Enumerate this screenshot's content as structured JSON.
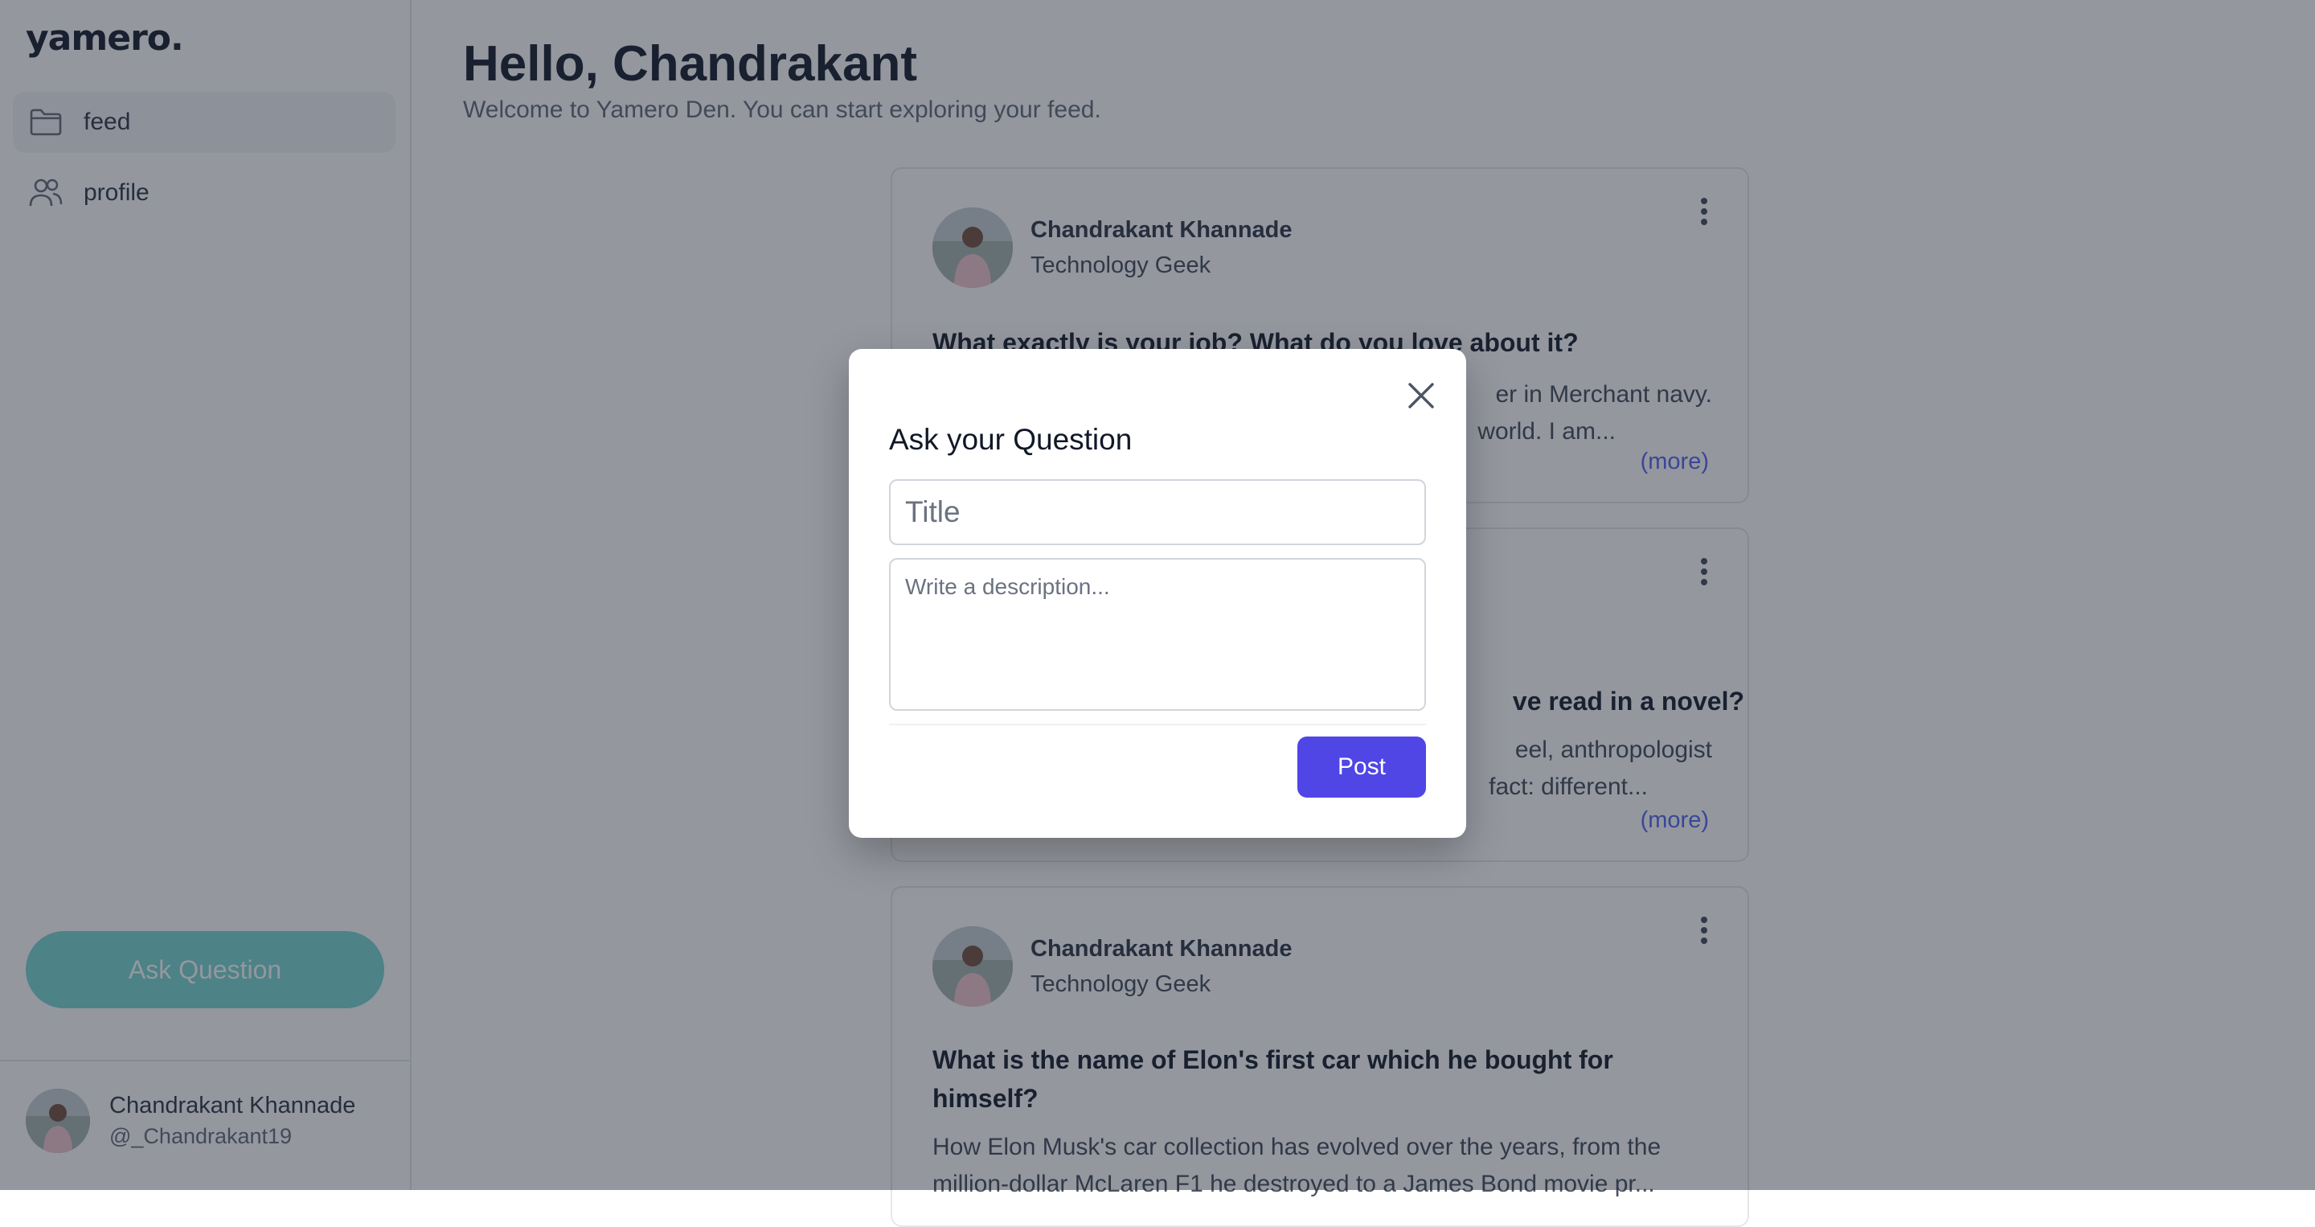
{
  "app": {
    "logo": "yamero."
  },
  "sidebar": {
    "items": [
      {
        "label": "feed",
        "icon": "folder-icon",
        "active": true
      },
      {
        "label": "profile",
        "icon": "users-icon",
        "active": false
      }
    ],
    "ask_button": "Ask Question",
    "user": {
      "name": "Chandrakant Khannade",
      "handle": "@_Chandrakant19"
    }
  },
  "header": {
    "greeting": "Hello, Chandrakant",
    "subtitle": "Welcome to Yamero Den. You can start exploring your feed."
  },
  "feed": {
    "posts": [
      {
        "author": "Chandrakant Khannade",
        "role": "Technology Geek",
        "title": "What exactly is your job? What do you love about it?",
        "body_line1": "er in Merchant navy.",
        "body_line2": "world. I am...",
        "more": "(more)"
      },
      {
        "title": "ve read in a novel?",
        "body_line1": "eel, anthropologist",
        "body_line2": "fact: different...",
        "more": "(more)"
      },
      {
        "author": "Chandrakant Khannade",
        "role": "Technology Geek",
        "title": "What is the name of Elon's first car which he bought for himself?",
        "body": "How Elon Musk's car collection has evolved over the years, from the million-dollar McLaren F1 he destroyed to a James Bond movie pr..."
      }
    ]
  },
  "modal": {
    "title": "Ask your Question",
    "title_placeholder": "Title",
    "description_placeholder": "Write a description...",
    "post_button": "Post"
  },
  "colors": {
    "primary": "#4f46e5",
    "ask_button": "#7fd9d5",
    "overlay": "rgba(17,24,39,0.45)"
  }
}
